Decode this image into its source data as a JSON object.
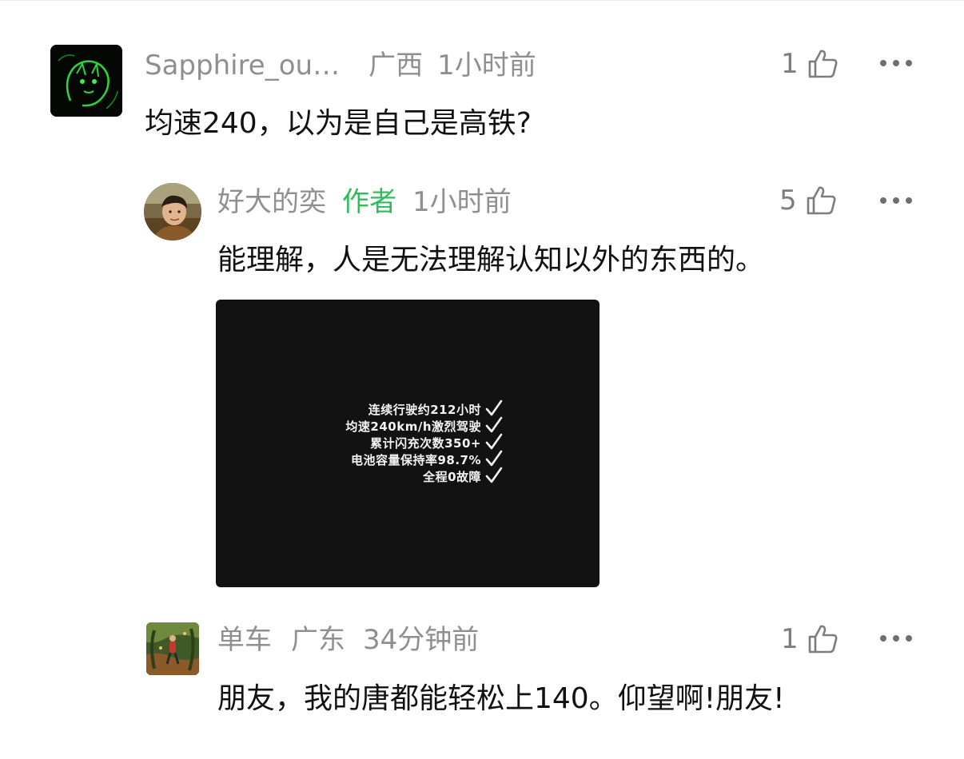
{
  "comments": [
    {
      "username": "Sapphire_ou…",
      "location": "广西",
      "time": "1小时前",
      "likes": "1",
      "text": "均速240，以为是自己是高铁?"
    },
    {
      "username": "好大的奕",
      "author_tag": "作者",
      "time": "1小时前",
      "likes": "5",
      "text": "能理解，人是无法理解认知以外的东西的。",
      "image": {
        "lines": [
          "连续行驶约212小时",
          "均速240km/h激烈驾驶",
          "累计闪充次数350+",
          "电池容量保持率98.7%",
          "全程0故障"
        ]
      }
    },
    {
      "username": "单车",
      "location": "广东",
      "time": "34分钟前",
      "likes": "1",
      "text": "朋友，我的唐都能轻松上140。仰望啊!朋友!"
    }
  ],
  "icons": {
    "like": "thumbs-up-icon",
    "more": "more-dots-icon",
    "check": "check-mark-icon"
  },
  "colors": {
    "author_tag": "#2fbd5e",
    "meta_text": "#8f8f8f",
    "image_bg": "#121212"
  }
}
